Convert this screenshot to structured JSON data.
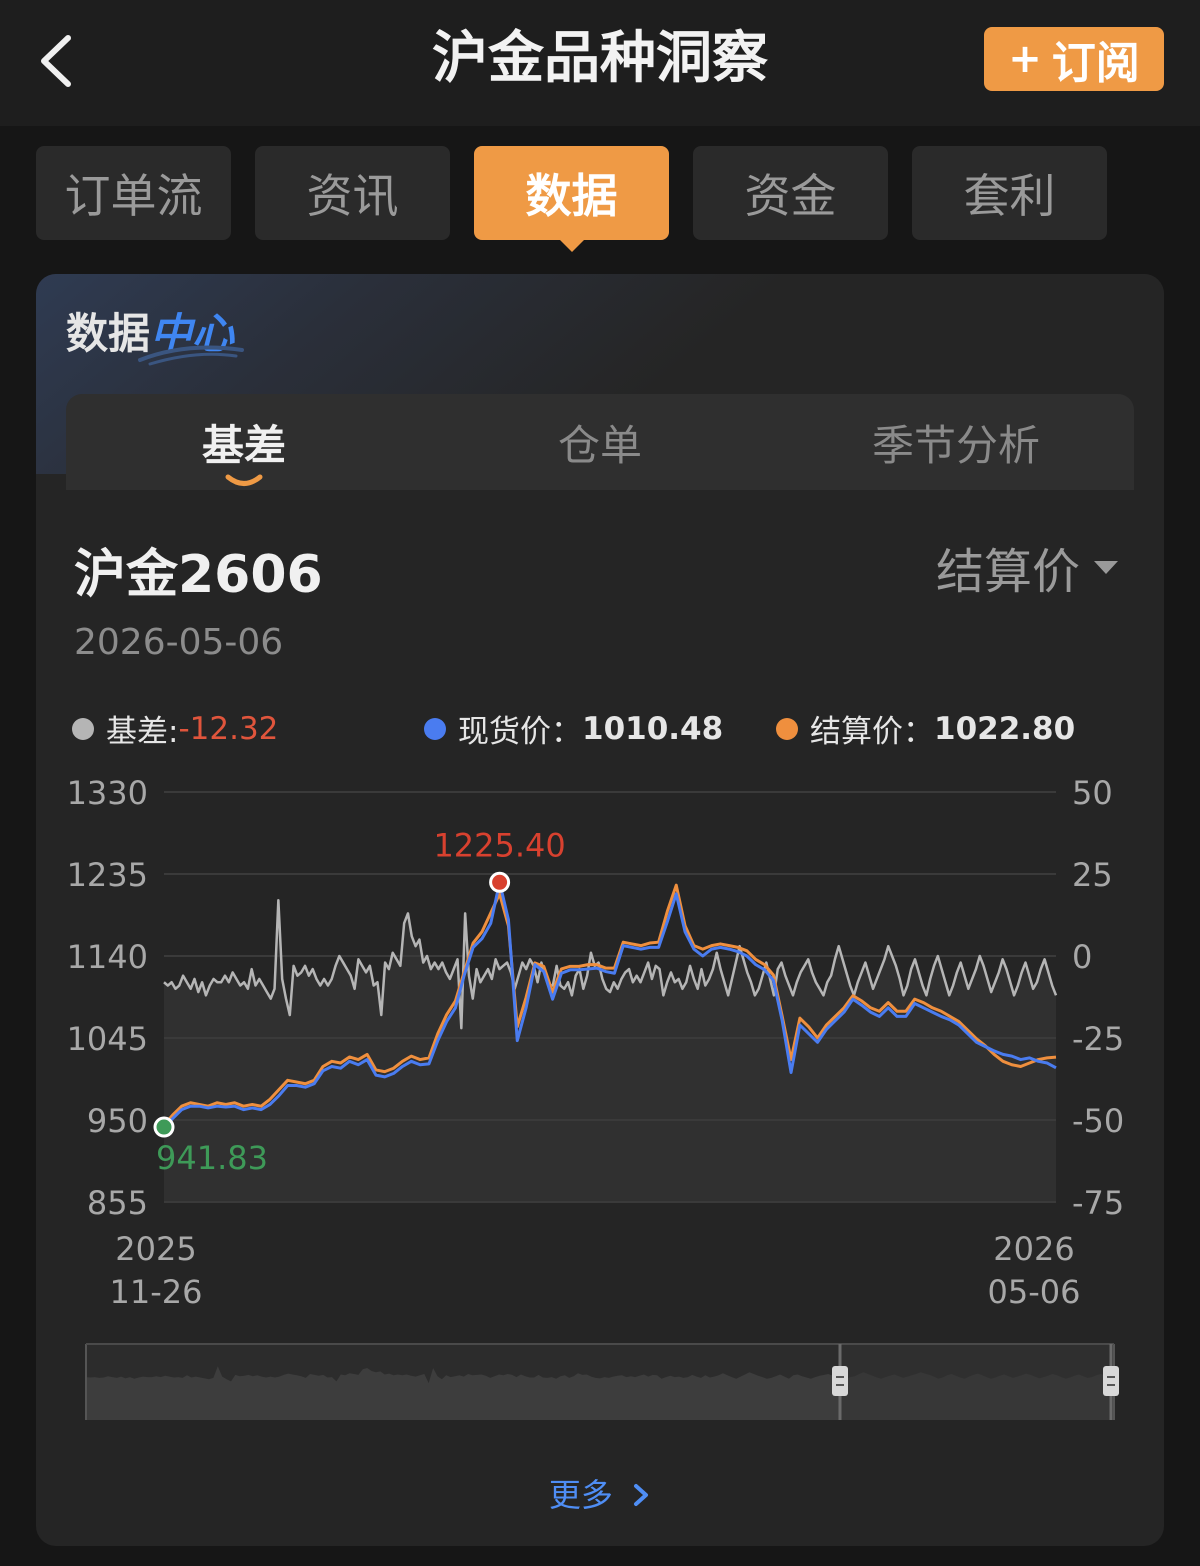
{
  "header": {
    "title": "沪金品种洞察",
    "subscribe_label": "订阅",
    "subscribe_plus": "+"
  },
  "tabs": [
    {
      "label": "订单流"
    },
    {
      "label": "资讯"
    },
    {
      "label": "数据",
      "active": true
    },
    {
      "label": "资金"
    },
    {
      "label": "套利"
    }
  ],
  "card": {
    "title_part1": "数据",
    "title_part2": "中心",
    "subtabs": [
      {
        "label": "基差",
        "active": true
      },
      {
        "label": "仓单"
      },
      {
        "label": "季节分析"
      }
    ],
    "contract": "沪金2606",
    "price_type": "结算价",
    "date": "2026-05-06",
    "legend": {
      "basis_label": "基差:",
      "basis_value": "-12.32",
      "spot_label": "现货价：",
      "spot_value": "1010.48",
      "settle_label": "结算价：",
      "settle_value": "1022.80"
    },
    "more_label": "更多"
  },
  "colors": {
    "accent": "#ef9a45",
    "spot": "#4a7cf0",
    "settle": "#ef8f3e",
    "basis": "#b5b5b5",
    "negative": "#e0553c",
    "min_marker": "#3e9a58",
    "max_marker": "#d8412f",
    "link": "#4f8ef5"
  },
  "chart_data": {
    "type": "line",
    "x_start": "2025-11-26",
    "x_end": "2026-05-06",
    "x_tick_labels": [
      {
        "year": "2025",
        "date": "11-26"
      },
      {
        "year": "2026",
        "date": "05-06"
      }
    ],
    "y_left": {
      "min": 855,
      "max": 1330,
      "ticks": [
        "1330",
        "1235",
        "1140",
        "1045",
        "950",
        "855"
      ]
    },
    "y_right": {
      "min": -75,
      "max": 50,
      "ticks": [
        "50",
        "25",
        "0",
        "-25",
        "-50",
        "-75"
      ]
    },
    "grid": true,
    "series": [
      {
        "name": "基差",
        "axis": "right",
        "values": [
          -8,
          -9,
          -8,
          -10,
          -9,
          -6,
          -8,
          -10,
          -7,
          -11,
          -8,
          -12,
          -9,
          -7,
          -8,
          -8,
          -6,
          -8,
          -5,
          -7,
          -9,
          -8,
          -10,
          -4,
          -9,
          -7,
          -9,
          -11,
          -13,
          -10,
          17,
          -7,
          -13,
          -18,
          -3,
          -6,
          -5,
          -3,
          -6,
          -4,
          -7,
          -9,
          -7,
          -9,
          -7,
          -3,
          0,
          -2,
          -4,
          -6,
          -10,
          -1,
          -3,
          -5,
          -3,
          -9,
          -8,
          -18,
          -2,
          -4,
          1,
          -1,
          -3,
          10,
          13,
          6,
          3,
          5,
          -2,
          0,
          -4,
          -2,
          -4,
          -2,
          -5,
          -7,
          -4,
          -1,
          -22,
          13,
          -6,
          -13,
          -4,
          -8,
          -6,
          -4,
          -7,
          -1,
          -4,
          -3,
          -2,
          -5,
          -10,
          -6,
          -2,
          -4,
          -1,
          -3,
          -8,
          -2,
          -6,
          -9,
          -9,
          -3,
          -9,
          -10,
          -8,
          -12,
          -6,
          -4,
          -10,
          -6,
          1,
          -3,
          -2,
          -7,
          -10,
          -11,
          -8,
          -10,
          -7,
          -5,
          -4,
          -8,
          -6,
          -8,
          -5,
          -2,
          -7,
          -3,
          -4,
          -12,
          -8,
          -5,
          -8,
          -7,
          -10,
          -8,
          -3,
          -7,
          -10,
          -4,
          -9,
          -7,
          -4,
          1,
          -4,
          -8,
          -12,
          -7,
          -2,
          3,
          -1,
          -5,
          -8,
          -12,
          -10,
          -6,
          -2,
          -7,
          -12,
          -4,
          -2,
          -6,
          -9,
          -12,
          -8,
          -5,
          -3,
          -1,
          -5,
          -8,
          -10,
          -12,
          -8,
          -6,
          -1,
          3,
          -1,
          -5,
          -9,
          -12,
          -8,
          -5,
          -2,
          -6,
          -10,
          -7,
          -4,
          -1,
          3,
          0,
          -3,
          -7,
          -12,
          -9,
          -4,
          -1,
          -5,
          -9,
          -12,
          -7,
          -3,
          0,
          -4,
          -8,
          -12,
          -9,
          -5,
          -2,
          -6,
          -10,
          -7,
          -4,
          0,
          -3,
          -7,
          -11,
          -8,
          -5,
          -1,
          -4,
          -8,
          -12,
          -9,
          -5,
          -2,
          -6,
          -10,
          -8,
          -4,
          -1,
          -5,
          -9,
          -12
        ]
      },
      {
        "name": "现货价",
        "axis": "left",
        "values": [
          941.83,
          952,
          962,
          966,
          966,
          964,
          966,
          965,
          966,
          962,
          964,
          962,
          968,
          978,
          990,
          990,
          988,
          992,
          1007,
          1012,
          1010,
          1018,
          1014,
          1020,
          1002,
          1000,
          1004,
          1012,
          1018,
          1014,
          1015,
          1042,
          1064,
          1080,
          1118,
          1150,
          1160,
          1178,
          1225.4,
          1182,
          1042,
          1080,
          1130,
          1122,
          1090,
          1120,
          1124,
          1124,
          1125,
          1126,
          1122,
          1120,
          1152,
          1150,
          1148,
          1150,
          1150,
          1180,
          1212,
          1168,
          1148,
          1140,
          1148,
          1150,
          1148,
          1145,
          1140,
          1130,
          1124,
          1112,
          1065,
          1005,
          1060,
          1050,
          1040,
          1055,
          1065,
          1075,
          1090,
          1083,
          1075,
          1070,
          1080,
          1070,
          1070,
          1085,
          1080,
          1075,
          1070,
          1066,
          1060,
          1050,
          1040,
          1035,
          1030,
          1026,
          1024,
          1020,
          1022,
          1018,
          1016,
          1010.48
        ]
      },
      {
        "name": "结算价",
        "axis": "left",
        "values": [
          944,
          956,
          966,
          970,
          968,
          966,
          970,
          968,
          970,
          966,
          968,
          966,
          974,
          985,
          996,
          994,
          992,
          996,
          1012,
          1018,
          1016,
          1023,
          1020,
          1026,
          1008,
          1006,
          1010,
          1018,
          1024,
          1020,
          1022,
          1050,
          1072,
          1088,
          1122,
          1155,
          1168,
          1190,
          1212,
          1175,
          1058,
          1092,
          1132,
          1128,
          1098,
          1125,
          1128,
          1128,
          1130,
          1130,
          1126,
          1126,
          1156,
          1154,
          1152,
          1155,
          1156,
          1192,
          1222,
          1175,
          1152,
          1148,
          1152,
          1154,
          1152,
          1150,
          1146,
          1136,
          1130,
          1118,
          1070,
          1020,
          1068,
          1058,
          1045,
          1060,
          1070,
          1080,
          1094,
          1088,
          1080,
          1076,
          1086,
          1076,
          1076,
          1090,
          1086,
          1080,
          1076,
          1070,
          1064,
          1054,
          1044,
          1036,
          1026,
          1018,
          1014,
          1012,
          1016,
          1020,
          1022,
          1022.8
        ]
      }
    ],
    "annotations": [
      {
        "label": "1225.40",
        "series": "现货价",
        "type": "max"
      },
      {
        "label": "941.83",
        "series": "现货价",
        "type": "min"
      }
    ]
  }
}
